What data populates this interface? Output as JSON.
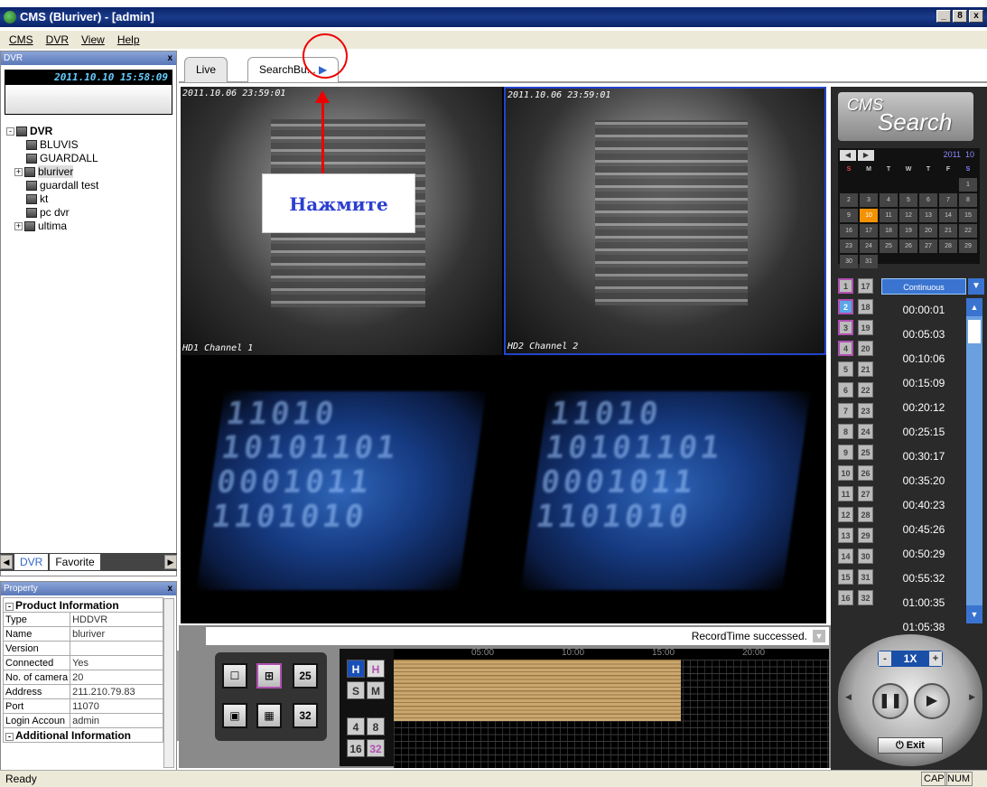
{
  "window": {
    "title": "CMS (Bluriver) - [admin]",
    "buttons": [
      "_",
      "8",
      "x"
    ]
  },
  "menu": [
    "CMS",
    "DVR",
    "View",
    "Help"
  ],
  "dvr_panel": {
    "title": "DVR",
    "close": "x",
    "clock": "2011.10.10 15:58:09",
    "tree": [
      {
        "label": "DVR",
        "toggle": "-",
        "level": 0
      },
      {
        "label": "BLUVIS",
        "toggle": "",
        "level": 1
      },
      {
        "label": "GUARDALL",
        "toggle": "",
        "level": 1
      },
      {
        "label": "bluriver",
        "toggle": "+",
        "level": 1,
        "selected": true
      },
      {
        "label": "guardall test",
        "toggle": "",
        "level": 1
      },
      {
        "label": "kt",
        "toggle": "",
        "level": 1
      },
      {
        "label": "pc dvr",
        "toggle": "",
        "level": 1
      },
      {
        "label": "ultima",
        "toggle": "+",
        "level": 1
      }
    ],
    "tabs": [
      "DVR",
      "Favorite"
    ]
  },
  "property_panel": {
    "title": "Property",
    "close": "x",
    "section1": "Product Information",
    "rows": [
      {
        "k": "Type",
        "v": "HDDVR"
      },
      {
        "k": "Name",
        "v": "bluriver"
      },
      {
        "k": "Version",
        "v": ""
      },
      {
        "k": "Connected",
        "v": "Yes"
      },
      {
        "k": "No. of camera",
        "v": "20"
      },
      {
        "k": "Address",
        "v": "211.210.79.83"
      },
      {
        "k": "Port",
        "v": "11070"
      },
      {
        "k": "Login Accoun",
        "v": "admin"
      }
    ],
    "section2": "Additional Information"
  },
  "main_tabs": [
    "Live",
    "SearchBu..."
  ],
  "cameras": [
    {
      "timestamp": "2011.10.06 23:59:01",
      "label": "HD1 Channel 1"
    },
    {
      "timestamp": "2011.10.06 23:59:01",
      "label": "HD2 Channel 2"
    }
  ],
  "nosignal_text": "11010 10101101 0001011 1101010",
  "record_status": "RecordTime successed.",
  "layout_buttons": [
    "",
    "",
    "25",
    "",
    "",
    "32"
  ],
  "hsm_buttons": {
    "H1": "H",
    "H2": "H",
    "S": "S",
    "M": "M",
    "n4": "4",
    "n8": "8",
    "n16": "16",
    "n32": "32"
  },
  "timeline_ticks": [
    "05:00",
    "10:00",
    "15:00",
    "20:00"
  ],
  "search_logo": {
    "a": "CMS",
    "b": "Search"
  },
  "calendar": {
    "year": "2011",
    "month": "10",
    "weekdays": [
      "S",
      "M",
      "T",
      "W",
      "T",
      "F",
      "S"
    ],
    "today": "10"
  },
  "camera_numbers": [
    "1",
    "17",
    "2",
    "18",
    "3",
    "19",
    "4",
    "20",
    "5",
    "21",
    "6",
    "22",
    "7",
    "23",
    "8",
    "24",
    "9",
    "25",
    "10",
    "26",
    "11",
    "27",
    "12",
    "28",
    "13",
    "29",
    "14",
    "30",
    "15",
    "31",
    "16",
    "32"
  ],
  "mode": "Continuous",
  "time_list": [
    "00:00:01",
    "00:05:03",
    "00:10:06",
    "00:15:09",
    "00:20:12",
    "00:25:15",
    "00:30:17",
    "00:35:20",
    "00:40:23",
    "00:45:26",
    "00:50:29",
    "00:55:32",
    "01:00:35",
    "01:05:38"
  ],
  "player": {
    "speed": "1X",
    "minus": "-",
    "plus": "+",
    "exit": "Exit"
  },
  "status": {
    "text": "Ready",
    "cap": "CAP",
    "num": "NUM"
  },
  "annotation": {
    "callout": "Нажмите"
  }
}
